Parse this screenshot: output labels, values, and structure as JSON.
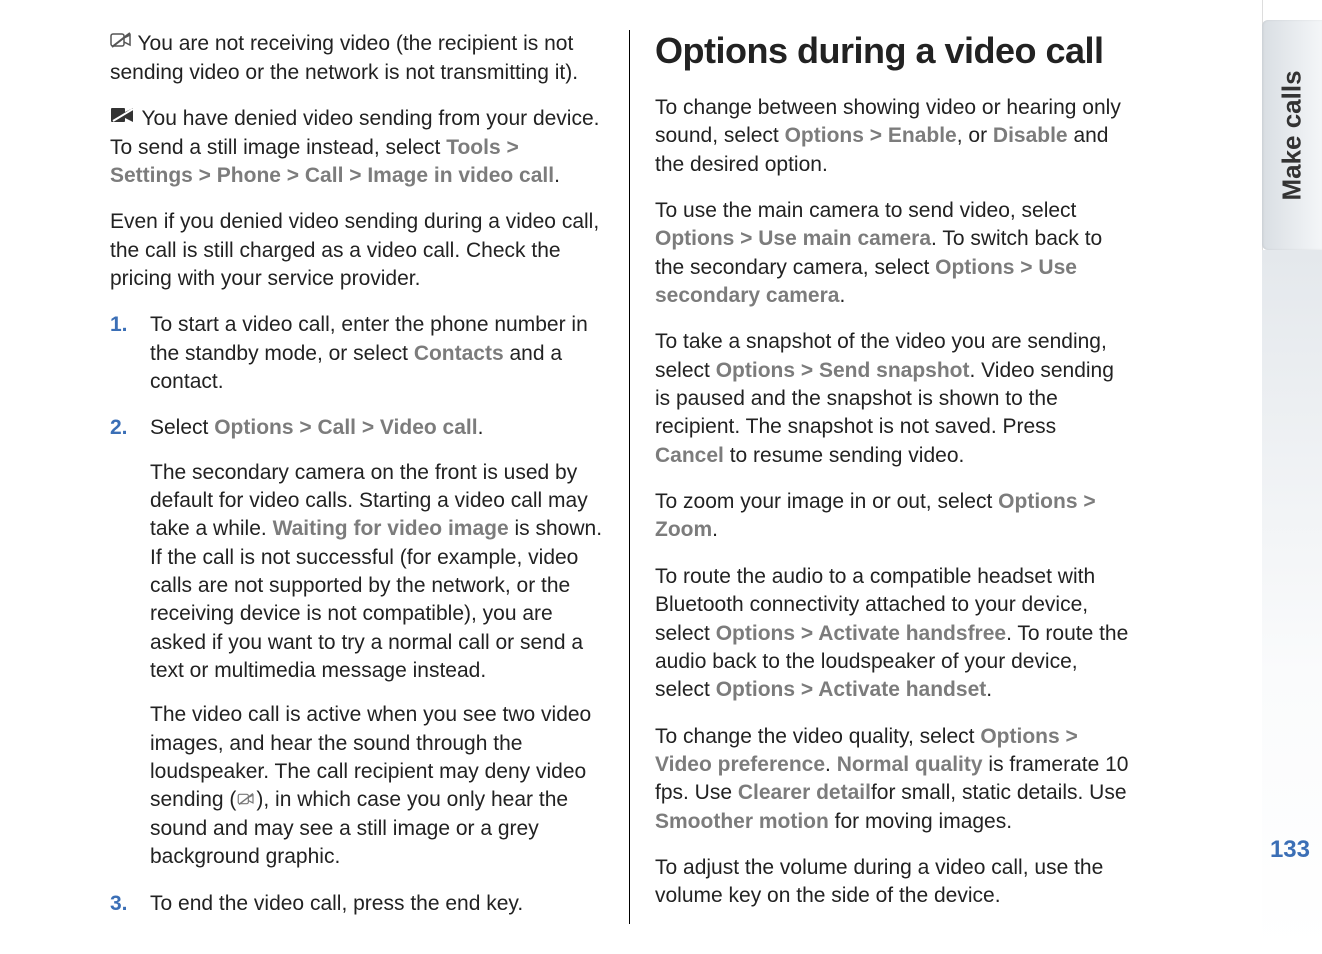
{
  "sideTab": "Make calls",
  "pageNumber": "133",
  "left": {
    "p1_a": " You are not receiving video (the recipient is not sending video or the network is not transmitting it).",
    "p2_a": " You have denied video sending from your device. To send a still image instead, select ",
    "p2_tools": "Tools",
    "p2_settings": "Settings",
    "p2_phone": "Phone",
    "p2_call": "Call",
    "p2_image": "Image in video call",
    "p3": "Even if you denied video sending during a video call, the call is still charged as a video call. Check the pricing with your service provider.",
    "li1_num": "1.",
    "li1_a": "To start a video call, enter the phone number in the standby mode, or select ",
    "li1_contacts": "Contacts",
    "li1_b": " and a contact.",
    "li2_num": "2.",
    "li2_a": "Select ",
    "li2_options": "Options",
    "li2_call": "Call",
    "li2_video": "Video call",
    "li2_p2a": "The secondary camera on the front is used by default for video calls. Starting a video call may take a while. ",
    "li2_wait": "Waiting for video image",
    "li2_p2b": " is shown. If the call is not successful (for example, video calls are not supported by the network, or the receiving device is not compatible), you are asked if you want to try a normal call or send a text or multimedia message instead.",
    "li2_p3a": "The video call is active when you see two video images, and hear the sound through the loudspeaker. The call recipient may deny video sending (",
    "li2_p3b": "), in which case you only hear the sound and may see a still image or a grey background graphic.",
    "li3_num": "3.",
    "li3_a": "To end the video call, press the end key."
  },
  "right": {
    "h1": "Options during a video call",
    "p1a": "To change between showing video or hearing only sound, select ",
    "p1_options": "Options",
    "p1_enable": "Enable",
    "p1_or": ", or ",
    "p1_disable": "Disable",
    "p1b": " and the desired option.",
    "p2a": "To use the main camera to send video, select ",
    "p2_options": "Options",
    "p2_main": "Use main camera",
    "p2b": ". To switch back to the secondary camera, select ",
    "p2_options2": "Options",
    "p2_secondary": "Use secondary camera",
    "p3a": "To take a snapshot of the video you are sending, select ",
    "p3_options": "Options",
    "p3_snapshot": "Send snapshot",
    "p3b": ". Video sending is paused and the snapshot is shown to the recipient. The snapshot is not saved. Press ",
    "p3_cancel": "Cancel",
    "p3c": " to resume sending video.",
    "p4a": "To zoom your image in or out, select ",
    "p4_options": "Options",
    "p4_zoom": "Zoom",
    "p5a": "To route the audio to a compatible headset with Bluetooth connectivity attached to your device, select ",
    "p5_options": "Options",
    "p5_handsfree": "Activate handsfree",
    "p5b": ". To route the audio back to the loudspeaker of your device, select ",
    "p5_options2": "Options",
    "p5_handset": "Activate handset",
    "p6a": "To change the video quality, select ",
    "p6_options": "Options",
    "p6_pref": "Video preference",
    "p6_normal": "Normal quality",
    "p6b": " is framerate 10 fps. Use ",
    "p6_clearer": "Clearer detail",
    "p6c": "for small, static details. Use ",
    "p6_smoother": "Smoother motion",
    "p6d": " for moving images.",
    "p7": "To adjust the volume during a video call, use the volume key on the side of the device."
  },
  "sep": " > "
}
